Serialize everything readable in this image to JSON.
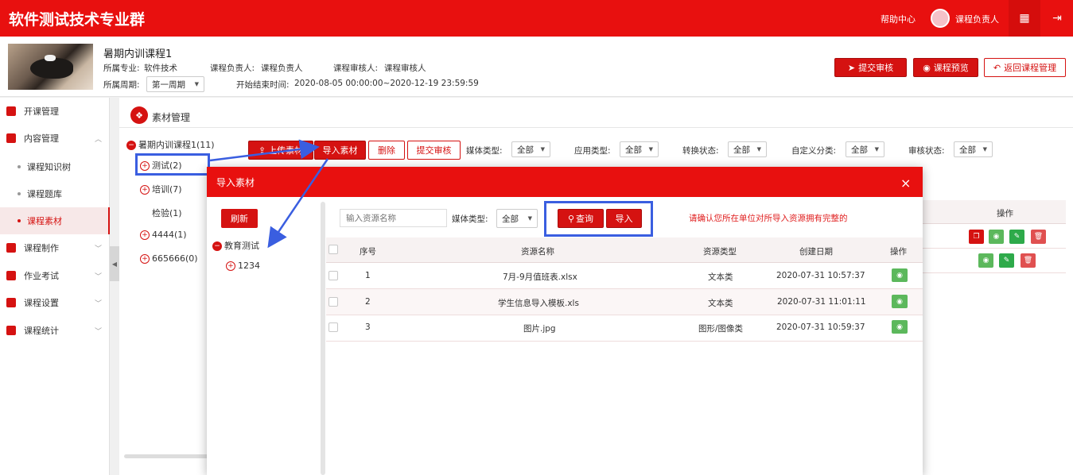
{
  "header": {
    "brand": "软件测试技术专业群",
    "help": "帮助中心",
    "user": "课程负责人",
    "grid_icon": "grid-icon",
    "logout_icon": "logout-icon"
  },
  "course": {
    "title": "暑期内训课程1",
    "major_label": "所属专业:",
    "major": "软件技术",
    "owner_label": "课程负责人:",
    "owner": "课程负责人",
    "reviewer_label": "课程审核人:",
    "reviewer": "课程审核人",
    "period_label": "所属周期:",
    "period_value": "第一周期",
    "time_label": "开始结束时间:",
    "time_range": "2020-08-05 00:00:00~2020-12-19 23:59:59",
    "submit_btn": "提交审核",
    "preview_btn": "课程预览",
    "back_btn": "返回课程管理"
  },
  "sidebar": {
    "items": [
      {
        "label": "开课管理"
      },
      {
        "label": "内容管理"
      },
      {
        "label": "课程知识树"
      },
      {
        "label": "课程题库"
      },
      {
        "label": "课程素材"
      },
      {
        "label": "课程制作"
      },
      {
        "label": "作业考试"
      },
      {
        "label": "课程设置"
      },
      {
        "label": "课程统计"
      }
    ],
    "collapse": "◀"
  },
  "panel": {
    "title": "素材管理",
    "tree": [
      "暑期内训课程1(11)",
      "测试(2)",
      "培训(7)",
      "检验(1)",
      "4444(1)",
      "665666(0)"
    ],
    "toolbar": {
      "upload": "上传素材",
      "import": "导入素材",
      "delete": "删除",
      "submit": "提交审核"
    },
    "filters": [
      {
        "label": "媒体类型:",
        "value": "全部"
      },
      {
        "label": "应用类型:",
        "value": "全部"
      },
      {
        "label": "转换状态:",
        "value": "全部"
      },
      {
        "label": "自定义分类:",
        "value": "全部"
      },
      {
        "label": "审核状态:",
        "value": "全部"
      }
    ],
    "ops_header": "操作"
  },
  "modal": {
    "title": "导入素材",
    "close": "×",
    "refresh": "刷新",
    "tree": [
      "教育测试",
      "1234"
    ],
    "search_placeholder": "输入资源名称",
    "media_label": "媒体类型:",
    "media_value": "全部",
    "query_btn": "查询",
    "import_btn": "导入",
    "warning": "请确认您所在单位对所导入资源拥有完整的",
    "columns": [
      "序号",
      "资源名称",
      "资源类型",
      "创建日期",
      "操作"
    ],
    "rows": [
      {
        "no": "1",
        "name": "7月-9月值班表.xlsx",
        "type": "文本类",
        "date": "2020-07-31 10:57:37"
      },
      {
        "no": "2",
        "name": "学生信息导入模板.xls",
        "type": "文本类",
        "date": "2020-07-31 11:01:11"
      },
      {
        "no": "3",
        "name": "图片.jpg",
        "type": "图形/图像类",
        "date": "2020-07-31 10:59:37"
      }
    ]
  },
  "colors": {
    "brand_red": "#e8100f",
    "button_red": "#d51211",
    "highlight_blue": "#3a5ee0",
    "view_green": "#5cb85c"
  }
}
